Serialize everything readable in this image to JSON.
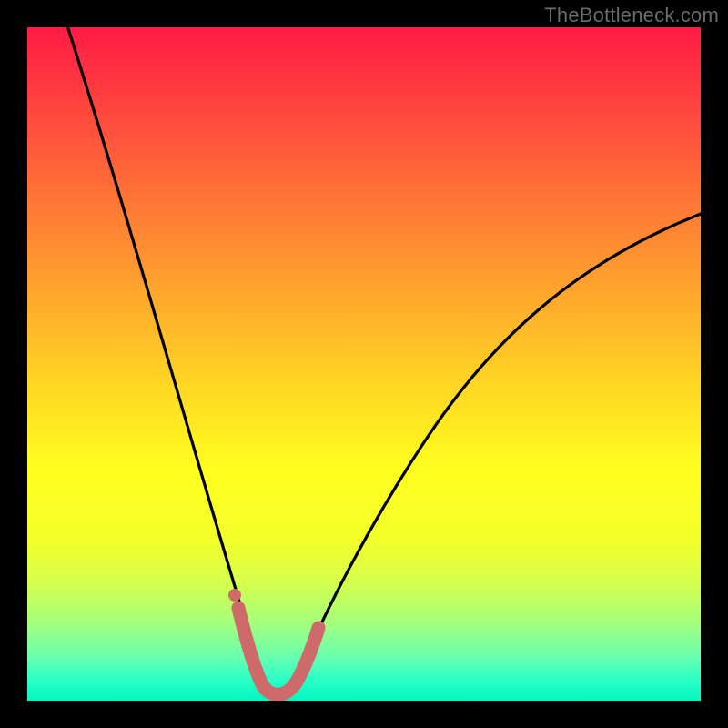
{
  "watermark": "TheBottleneck.com",
  "chart_data": {
    "type": "line",
    "title": "",
    "xlabel": "",
    "ylabel": "",
    "xlim": [
      0,
      100
    ],
    "ylim": [
      0,
      100
    ],
    "series": [
      {
        "name": "bottleneck-curve",
        "color": "#000000",
        "x": [
          0,
          5,
          10,
          15,
          20,
          25,
          28,
          30,
          32,
          34,
          36,
          38,
          40,
          45,
          50,
          55,
          60,
          65,
          70,
          75,
          80,
          85,
          90,
          95,
          100
        ],
        "values": [
          103,
          90,
          77,
          64,
          50,
          35,
          24,
          14,
          6,
          2,
          0,
          0,
          2,
          9,
          18,
          27,
          35,
          42,
          48,
          53,
          58,
          62,
          66,
          69,
          72
        ]
      },
      {
        "name": "highlight-band",
        "color": "#cf6a6a",
        "x": [
          28,
          30,
          32,
          34,
          36,
          38,
          40
        ],
        "values": [
          13,
          7,
          3,
          1,
          1,
          2,
          6
        ]
      }
    ],
    "markers": [
      {
        "name": "highlight-dot",
        "x": 29,
        "y": 12,
        "color": "#cf6a6a"
      }
    ]
  }
}
